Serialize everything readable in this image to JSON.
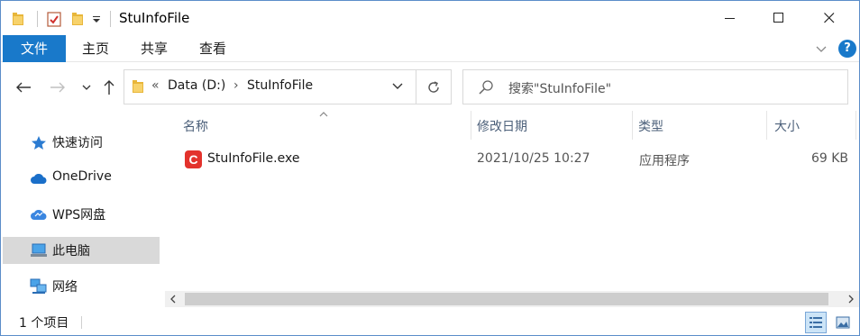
{
  "window": {
    "title": "StuInfoFile"
  },
  "ribbon": {
    "tabs": [
      {
        "label": "文件"
      },
      {
        "label": "主页"
      },
      {
        "label": "共享"
      },
      {
        "label": "查看"
      }
    ],
    "help_label": "?"
  },
  "address": {
    "lead": "«",
    "crumbs": [
      {
        "label": "Data (D:)"
      },
      {
        "label": "StuInfoFile"
      }
    ],
    "separator": "›"
  },
  "search": {
    "placeholder": "搜索\"StuInfoFile\""
  },
  "sidebar": {
    "items": [
      {
        "label": "快速访问",
        "icon": "star-icon"
      },
      {
        "label": "OneDrive",
        "icon": "cloud-icon"
      },
      {
        "label": "WPS网盘",
        "icon": "wps-cloud-icon"
      },
      {
        "label": "此电脑",
        "icon": "computer-icon",
        "selected": true
      },
      {
        "label": "网络",
        "icon": "network-icon"
      }
    ]
  },
  "columns": {
    "name": "名称",
    "modified": "修改日期",
    "type": "类型",
    "size": "大小"
  },
  "files": [
    {
      "name": "StuInfoFile.exe",
      "icon_letter": "C",
      "modified": "2021/10/25 10:27",
      "type": "应用程序",
      "size": "69 KB"
    }
  ],
  "status": {
    "item_count": "1 个项目"
  },
  "colors": {
    "accent": "#1979ca",
    "exe_icon": "#e3322c",
    "selected_bg": "#d9d9d9",
    "header_text": "#4c607a"
  }
}
